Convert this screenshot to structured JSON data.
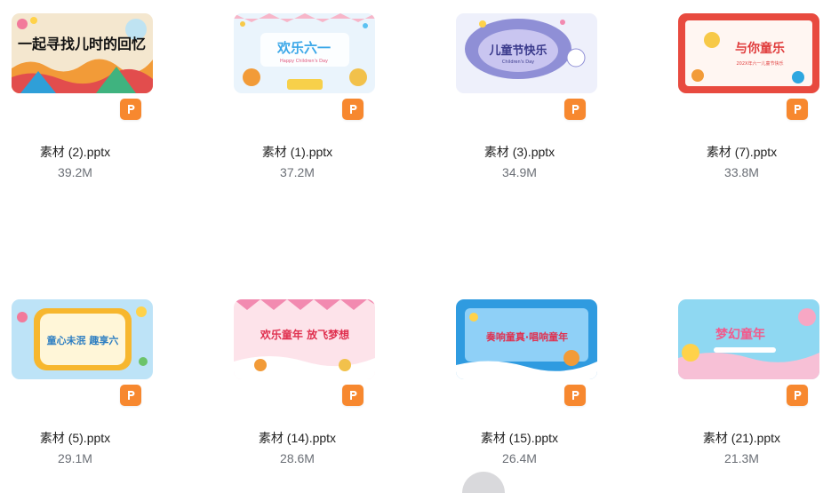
{
  "files": [
    {
      "name": "素材 (2).pptx",
      "size": "39.2M",
      "thumb_title": "一起寻找儿时的回忆",
      "file_icon": "ppt-icon"
    },
    {
      "name": "素材 (1).pptx",
      "size": "37.2M",
      "thumb_title": "欢乐六一",
      "file_icon": "ppt-icon"
    },
    {
      "name": "素材 (3).pptx",
      "size": "34.9M",
      "thumb_title": "儿童节快乐",
      "file_icon": "ppt-icon"
    },
    {
      "name": "素材 (7).pptx",
      "size": "33.8M",
      "thumb_title": "与你童乐",
      "file_icon": "ppt-icon"
    },
    {
      "name": "素材 (5).pptx",
      "size": "29.1M",
      "thumb_title": "童心未泯 趣享六",
      "file_icon": "ppt-icon"
    },
    {
      "name": "素材 (14).pptx",
      "size": "28.6M",
      "thumb_title": "欢乐童年 放飞梦想",
      "file_icon": "ppt-icon"
    },
    {
      "name": "素材 (15).pptx",
      "size": "26.4M",
      "thumb_title": "奏响童真·唱响童年",
      "file_icon": "ppt-icon"
    },
    {
      "name": "素材 (21).pptx",
      "size": "21.3M",
      "thumb_title": "梦幻童年",
      "file_icon": "ppt-icon"
    }
  ],
  "thumb_subtitles": {
    "f1": "Happy Children's Day",
    "f2": "Children's Day",
    "f3": "202X年六一儿童节快乐"
  },
  "colors": {
    "ppt_badge": "#f7882f",
    "file_name": "#1f1f1f",
    "file_size": "#6b6f76"
  }
}
